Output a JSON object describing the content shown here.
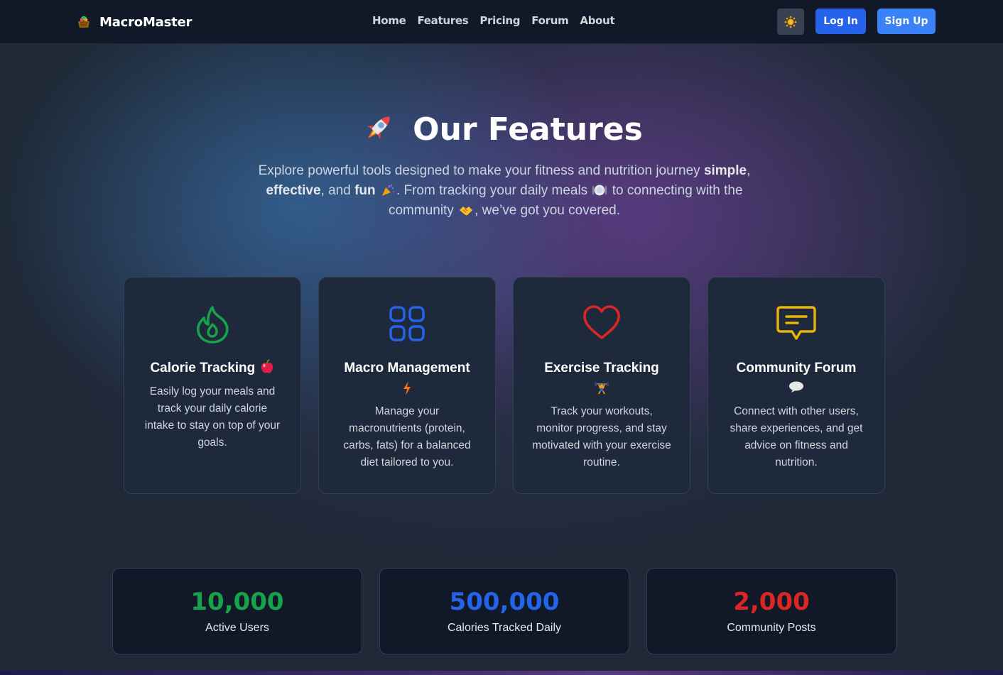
{
  "nav": {
    "brand": "MacroMaster",
    "links": [
      "Home",
      "Features",
      "Pricing",
      "Forum",
      "About"
    ],
    "theme_icon": "sun-icon",
    "login_label": "Log In",
    "signup_label": "Sign Up"
  },
  "hero": {
    "title": "Our Features",
    "title_icon": "rocket-icon",
    "desc_1": "Explore powerful tools designed to make your fitness and nutrition journey ",
    "desc_simple": "simple",
    "desc_2": ", ",
    "desc_effective": "effective",
    "desc_3": ", and ",
    "desc_fun": "fun",
    "desc_4": ". From tracking your daily meals ",
    "desc_5": " to connecting with the community ",
    "desc_6": ", we’ve got you covered."
  },
  "features": [
    {
      "title": "Calorie Tracking",
      "icon": "flame-icon",
      "emoji": "apple-icon",
      "desc": "Easily log your meals and track your daily calorie intake to stay on top of your goals."
    },
    {
      "title": "Macro Management",
      "icon": "grid-icon",
      "emoji": "lightning-icon",
      "desc": "Manage your macronutrients (protein, carbs, fats) for a balanced diet tailored to you."
    },
    {
      "title": "Exercise Tracking",
      "icon": "heart-icon",
      "emoji": "weightlifter-icon",
      "desc": "Track your workouts, monitor progress, and stay motivated with your exercise routine."
    },
    {
      "title": "Community Forum",
      "icon": "chat-icon",
      "emoji": "speech-bubble-icon",
      "desc": "Connect with other users, share experiences, and get advice on fitness and nutrition."
    }
  ],
  "stats": [
    {
      "value": "10,000",
      "label": "Active Users",
      "color": "#16a34a"
    },
    {
      "value": "500,000",
      "label": "Calories Tracked Daily",
      "color": "#2563eb"
    },
    {
      "value": "2,000",
      "label": "Community Posts",
      "color": "#dc2626"
    }
  ],
  "colors": {
    "flame": "#16a34a",
    "grid": "#2563eb",
    "heart": "#dc2626",
    "chat": "#eab308"
  }
}
